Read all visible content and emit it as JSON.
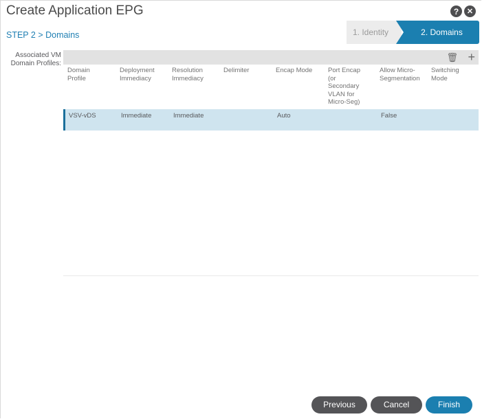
{
  "dialog": {
    "title": "Create Application EPG",
    "step_label": "STEP 2 > Domains",
    "help_icon": "?",
    "close_icon": "✕"
  },
  "wizard": {
    "steps": [
      {
        "label": "1. Identity",
        "active": false
      },
      {
        "label": "2. Domains",
        "active": true
      }
    ]
  },
  "colors": {
    "accent": "#1b7fb0",
    "selected_row": "#cfe4ef",
    "button_dark": "#545457"
  },
  "vm_domain_profiles": {
    "label": "Associated VM Domain Profiles:",
    "toolbar": {
      "delete_icon": "🗑",
      "add_icon": "+"
    },
    "columns": [
      "Domain Profile",
      "Deployment Immediacy",
      "Resolution Immediacy",
      "Delimiter",
      "Encap Mode",
      "Port Encap (or Secondary VLAN for Micro-Seg)",
      "Allow Micro-Segmentation",
      "Switching Mode"
    ],
    "rows": [
      [
        "VSV-vDS",
        "Immediate",
        "Immediate",
        "",
        "Auto",
        "",
        "False",
        ""
      ]
    ]
  },
  "footer": {
    "previous_label": "Previous",
    "cancel_label": "Cancel",
    "finish_label": "Finish"
  }
}
